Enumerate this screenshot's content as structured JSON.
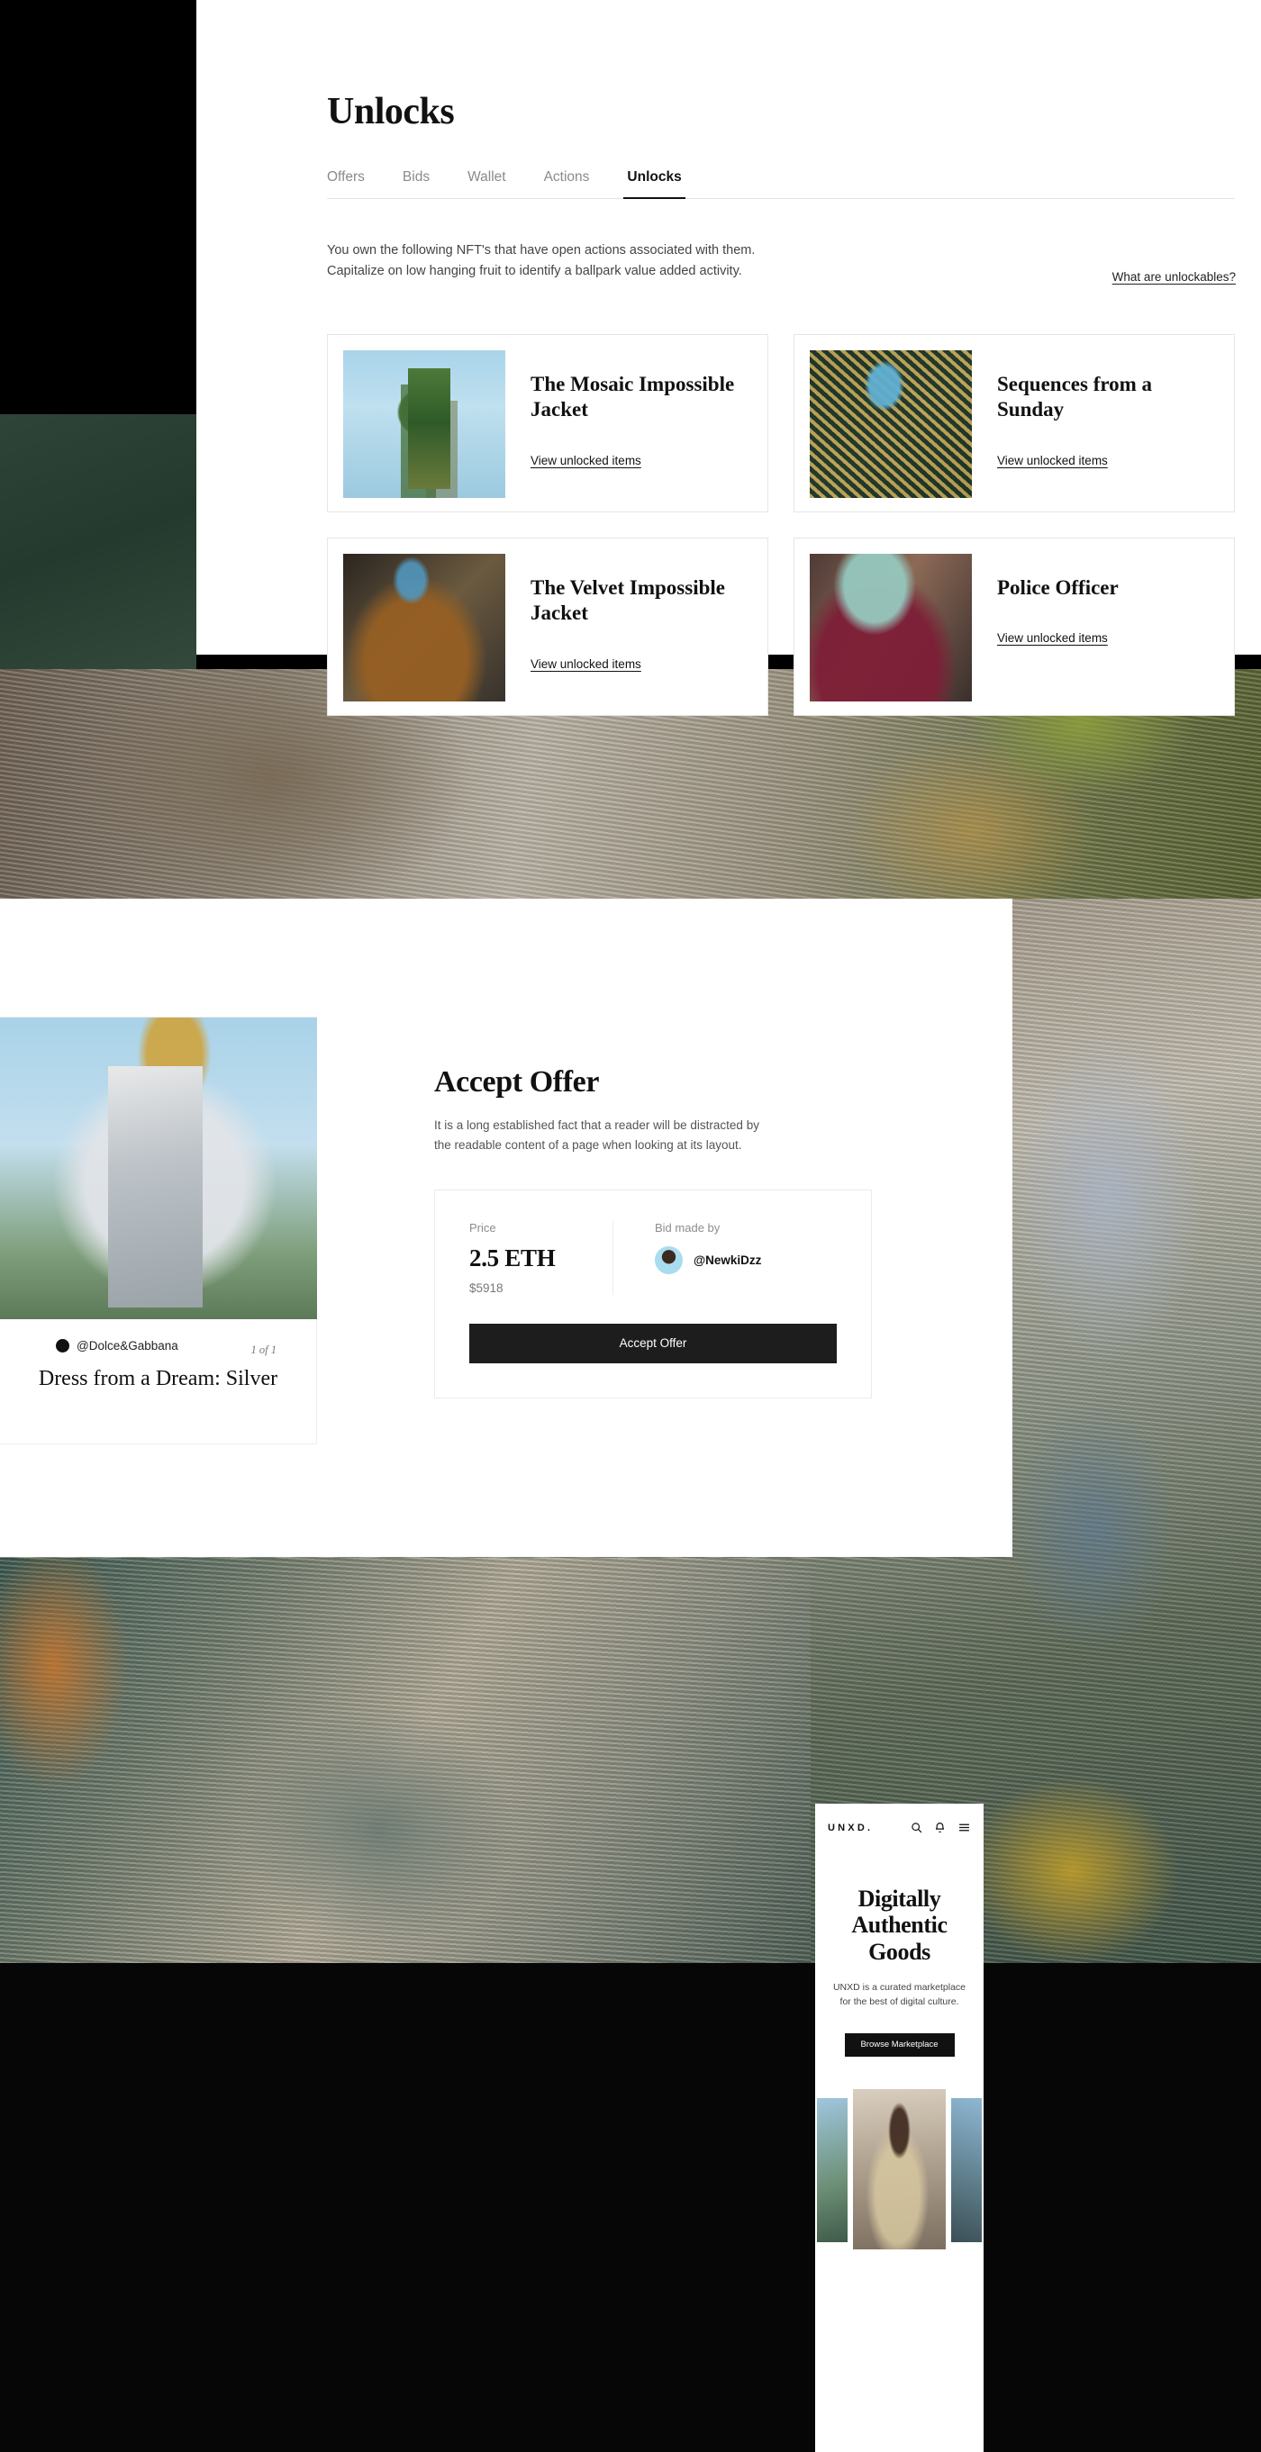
{
  "unlocks": {
    "title": "Unlocks",
    "tabs": [
      {
        "label": "Offers",
        "active": false
      },
      {
        "label": "Bids",
        "active": false
      },
      {
        "label": "Wallet",
        "active": false
      },
      {
        "label": "Actions",
        "active": false
      },
      {
        "label": "Unlocks",
        "active": true
      }
    ],
    "intro_line1": "You own the following NFT's that have open actions associated with them.",
    "intro_line2": "Capitalize on low hanging fruit to identify a ballpark value added activity.",
    "unlockables_link": "What are unlockables?",
    "cards": [
      {
        "name": "The Mosaic Impossible Jacket",
        "link": "View unlocked items"
      },
      {
        "name": "Sequences from a Sunday",
        "link": "View unlocked items"
      },
      {
        "name": "The Velvet Impossible Jacket",
        "link": "View unlocked items"
      },
      {
        "name": "Police Officer",
        "link": "View unlocked items"
      }
    ]
  },
  "accept_offer": {
    "title": "Accept Offer",
    "description": "It is a long established fact that a reader will be distracted by the readable content of a page when looking at its layout.",
    "price_label": "Price",
    "price_eth": "2.5 ETH",
    "price_usd": "$5918",
    "bid_label": "Bid made by",
    "bidder": "@NewkiDzz",
    "button": "Accept Offer",
    "nft": {
      "creator": "@Dolce&Gabbana",
      "edition": "1 of 1",
      "title": "Dress from a Dream: Silver"
    }
  },
  "mobile": {
    "logo": "UNXD.",
    "hero_title": "Digitally Authentic Goods",
    "hero_sub": "UNXD is a curated marketplace for the best of digital culture.",
    "cta": "Browse Marketplace"
  }
}
